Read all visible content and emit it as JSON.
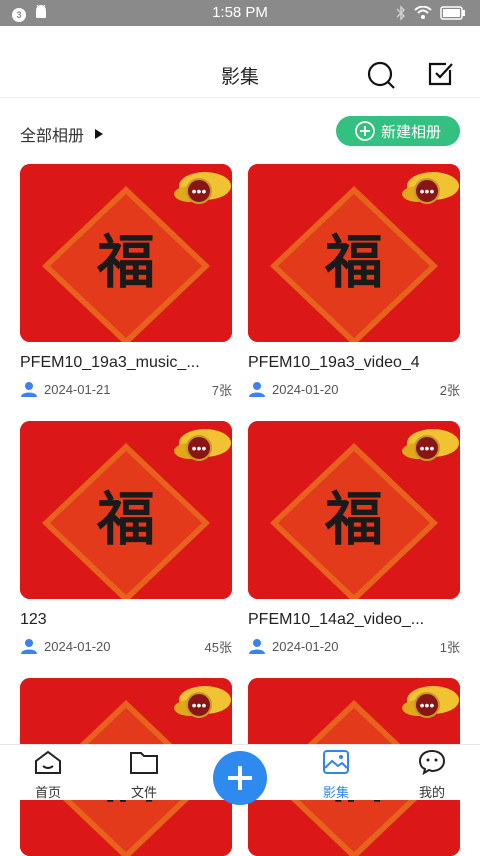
{
  "status_bar": {
    "time": "1:58 PM",
    "notification_badge": "3"
  },
  "header": {
    "title": "影集"
  },
  "album_bar": {
    "all_albums_label": "全部相册",
    "new_album_label": "新建相册"
  },
  "albums": [
    {
      "name": "PFEM10_19a3_music_...",
      "date": "2024-01-21",
      "count": "7张"
    },
    {
      "name": "PFEM10_19a3_video_4",
      "date": "2024-01-20",
      "count": "2张"
    },
    {
      "name": "123",
      "date": "2024-01-20",
      "count": "45张"
    },
    {
      "name": "PFEM10_14a2_video_...",
      "date": "2024-01-20",
      "count": "1张"
    },
    {
      "name": "",
      "date": "",
      "count": ""
    },
    {
      "name": "",
      "date": "",
      "count": ""
    }
  ],
  "tabbar": {
    "home": "首页",
    "files": "文件",
    "albums": "影集",
    "mine": "我的"
  },
  "colors": {
    "accent_blue": "#2f86e8",
    "new_button_green": "#33c080",
    "thumb_red": "#e11a1a"
  }
}
